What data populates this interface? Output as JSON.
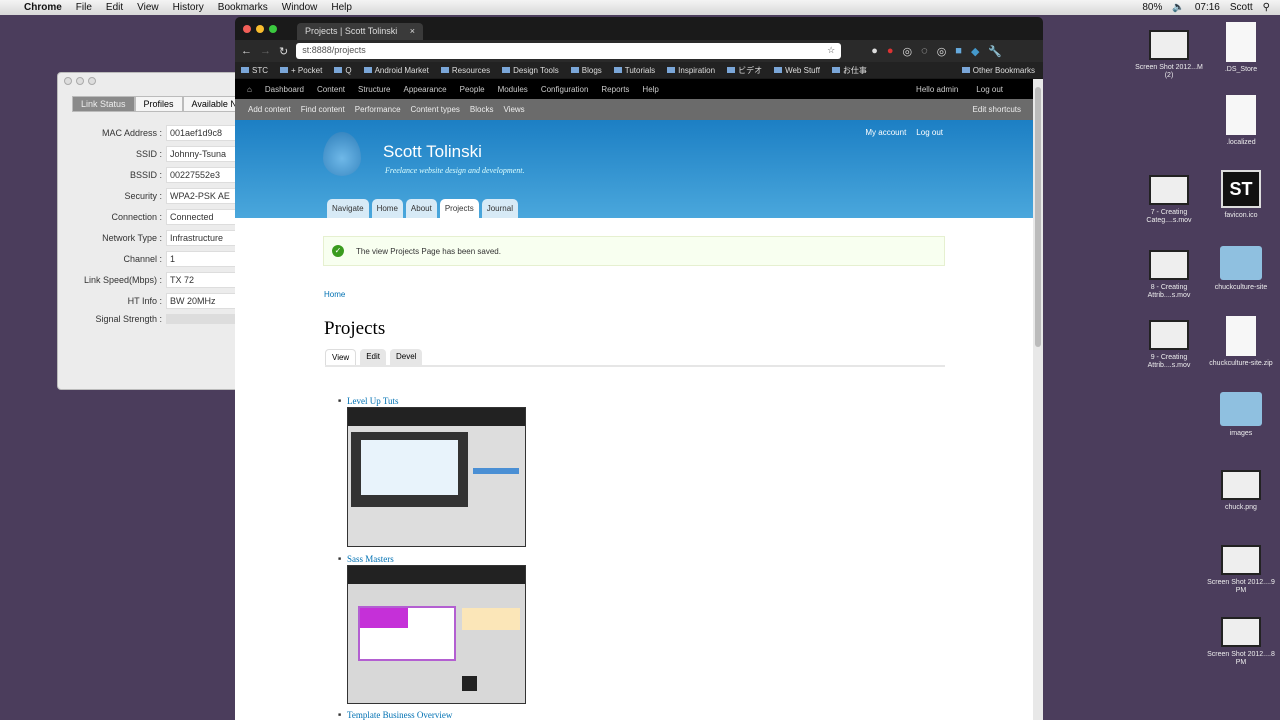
{
  "menubar": {
    "app": "Chrome",
    "items": [
      "File",
      "Edit",
      "View",
      "History",
      "Bookmarks",
      "Window",
      "Help"
    ],
    "battery": "80%",
    "time": "07:16",
    "user": "Scott"
  },
  "network": {
    "tabs": [
      "Link Status",
      "Profiles",
      "Available N"
    ],
    "rows": [
      {
        "label": "MAC Address :",
        "value": "001aef1d9c8"
      },
      {
        "label": "SSID :",
        "value": "Johnny-Tsuna"
      },
      {
        "label": "BSSID :",
        "value": "00227552e3"
      },
      {
        "label": "Security :",
        "value": "WPA2-PSK AE"
      },
      {
        "label": "Connection :",
        "value": "Connected"
      },
      {
        "label": "Network Type :",
        "value": "Infrastructure"
      },
      {
        "label": "Channel :",
        "value": "1"
      },
      {
        "label": "Link Speed(Mbps) :",
        "value": "TX  72"
      },
      {
        "label": "HT Info :",
        "value": "BW 20MHz"
      },
      {
        "label": "Signal Strength :",
        "value": ""
      }
    ]
  },
  "browser": {
    "tab_title": "Projects | Scott Tolinski",
    "url": "st:8888/projects",
    "bookmarks": [
      "STC",
      "+ Pocket",
      "Q",
      "Android Market",
      "Resources",
      "Design Tools",
      "Blogs",
      "Tutorials",
      "Inspiration",
      "ビデオ",
      "Web Stuff",
      "お仕事"
    ],
    "other_bookmarks": "Other Bookmarks"
  },
  "admin": {
    "items": [
      "Dashboard",
      "Content",
      "Structure",
      "Appearance",
      "People",
      "Modules",
      "Configuration",
      "Reports",
      "Help"
    ],
    "hello": "Hello admin",
    "logout": "Log out",
    "shortcuts": [
      "Add content",
      "Find content",
      "Performance",
      "Content types",
      "Blocks",
      "Views"
    ],
    "edit_shortcuts": "Edit shortcuts"
  },
  "site": {
    "name": "Scott Tolinski",
    "slogan": "Freelance website design and development.",
    "secondary": [
      "My account",
      "Log out"
    ],
    "nav": [
      "Navigate",
      "Home",
      "About",
      "Projects",
      "Journal"
    ],
    "message": "The view Projects Page has been saved.",
    "breadcrumb": "Home",
    "title": "Projects",
    "local_tabs": [
      "View",
      "Edit",
      "Devel"
    ],
    "projects": [
      "Level Up Tuts",
      "Sass Masters",
      "Template Business Overview"
    ]
  },
  "desktop": [
    {
      "label": "Screen Shot 2012...M (2)"
    },
    {
      "label": ".DS_Store"
    },
    {
      "label": ".localized"
    },
    {
      "label": "7 - Creating Categ....s.mov"
    },
    {
      "label": "favicon.ico"
    },
    {
      "label": "8 - Creating Attrib....s.mov"
    },
    {
      "label": "chuckculture-site"
    },
    {
      "label": "9 - Creating Attrib....s.mov"
    },
    {
      "label": "chuckculture-site.zip"
    },
    {
      "label": "images"
    },
    {
      "label": "chuck.png"
    },
    {
      "label": "Screen Shot 2012....9 PM"
    },
    {
      "label": "Screen Shot 2012....8 PM"
    }
  ]
}
